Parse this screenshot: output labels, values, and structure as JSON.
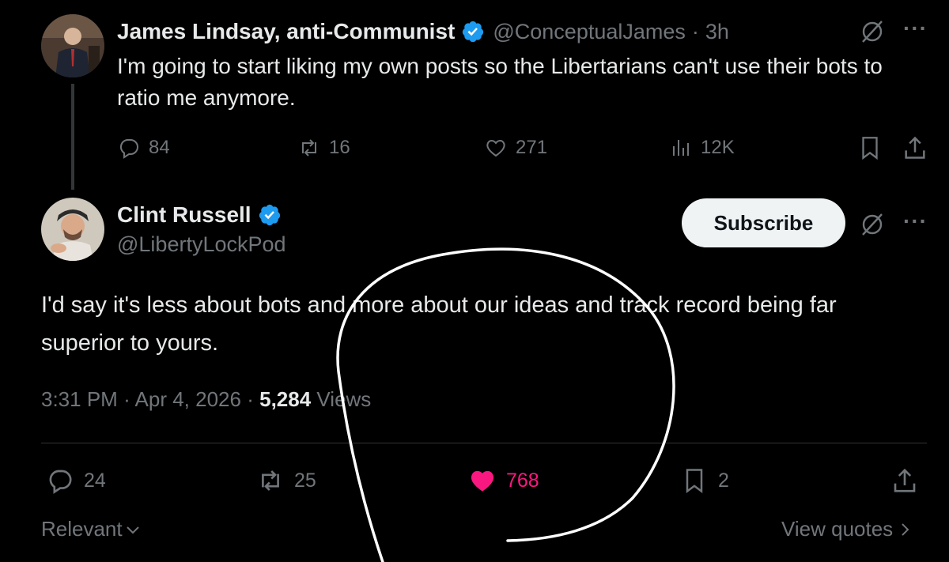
{
  "parent_tweet": {
    "author_name": "James Lindsay, anti-Communist",
    "handle": "@ConceptualJames",
    "separator": "·",
    "time": "3h",
    "text": "I'm going to start liking my own posts so the Libertarians can't use their bots to ratio me anymore.",
    "stats": {
      "replies": "84",
      "reposts": "16",
      "likes": "271",
      "views": "12K"
    }
  },
  "main_tweet": {
    "author_name": "Clint Russell",
    "handle": "@LibertyLockPod",
    "subscribe_label": "Subscribe",
    "text": "I'd say it's less about bots and more about our ideas and track record being far superior to yours.",
    "meta": {
      "time": "3:31 PM",
      "sep1": "·",
      "date": "Apr 4, 2026",
      "sep2": "·",
      "views_count": "5,284",
      "views_label": "Views"
    },
    "stats": {
      "replies": "24",
      "reposts": "25",
      "likes": "768",
      "bookmarks": "2"
    }
  },
  "footer": {
    "sort_label": "Relevant",
    "quotes_label": "View quotes"
  },
  "colors": {
    "like_active": "#f91880",
    "verified": "#1d9bf0",
    "button_bg": "#eff3f4"
  },
  "icons": [
    "reply-icon",
    "repost-icon",
    "like-icon",
    "views-icon",
    "bookmark-icon",
    "share-icon",
    "grok-icon",
    "more-icon",
    "verified-icon",
    "chevron-down-icon",
    "chevron-right-icon"
  ]
}
